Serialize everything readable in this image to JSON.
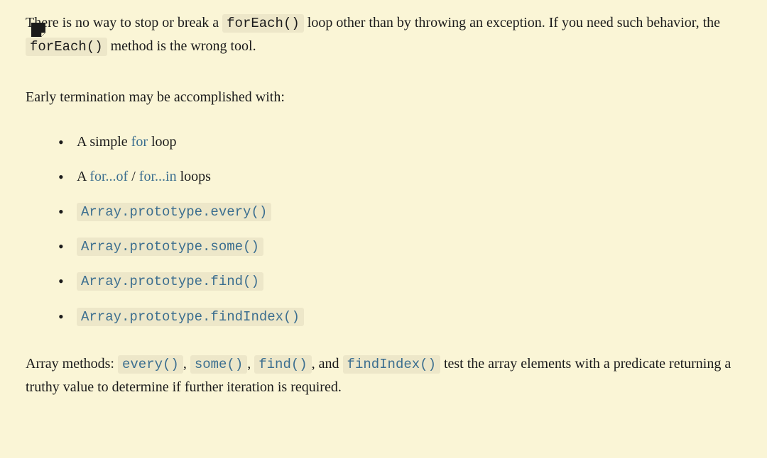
{
  "para1": {
    "pre": "There is no way to stop or break a ",
    "code1": "forEach()",
    "mid": " loop other than by throwing an exception. If you need such behavior, the ",
    "code2": "forEach()",
    "post": " method is the wrong tool."
  },
  "para2": "Early termination may be accomplished with:",
  "list": {
    "item1": {
      "pre": "A simple ",
      "link": "for",
      "post": " loop"
    },
    "item2": {
      "pre": "A ",
      "link1": "for...of",
      "sep": " / ",
      "link2": "for...in",
      "post": " loops"
    },
    "item3": "Array.prototype.every()",
    "item4": "Array.prototype.some()",
    "item5": "Array.prototype.find()",
    "item6": "Array.prototype.findIndex()"
  },
  "para3": {
    "pre": "Array methods: ",
    "c1": "every()",
    "s1": ", ",
    "c2": "some()",
    "s2": ", ",
    "c3": "find()",
    "s3": ", and ",
    "c4": "findIndex()",
    "post": " test the array elements with a predicate returning a truthy value to determine if further iteration is required."
  }
}
